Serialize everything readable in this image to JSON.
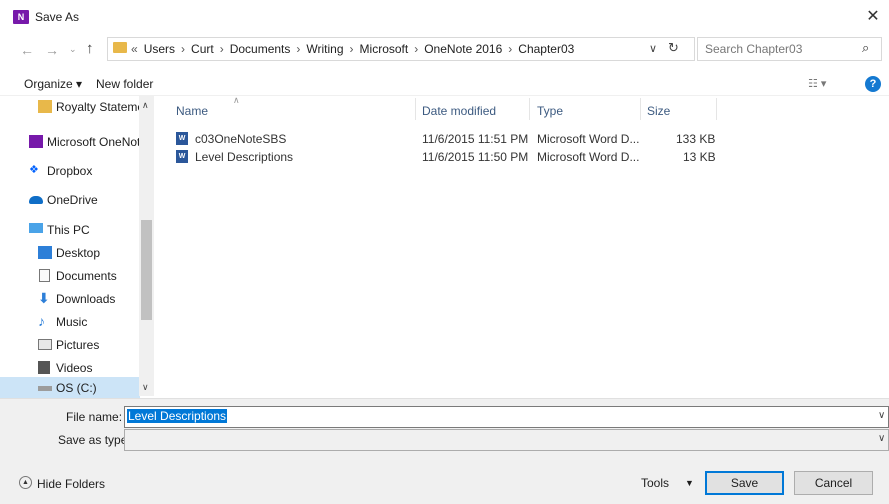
{
  "window": {
    "title": "Save As",
    "app_icon_text": "N",
    "close_glyph": "✕"
  },
  "address": {
    "overflow": "«",
    "path": [
      "Users",
      "Curt",
      "Documents",
      "Writing",
      "Microsoft",
      "OneNote 2016",
      "Chapter03"
    ],
    "search_placeholder": "Search Chapter03"
  },
  "toolbar": {
    "organize_label": "Organize ▾",
    "new_folder_label": "New folder"
  },
  "nav": {
    "items": [
      {
        "label": "Royalty Stateme",
        "icon": "folder-icon"
      },
      {
        "label": "Microsoft OneNot",
        "icon": "onenote-icon"
      },
      {
        "label": "Dropbox",
        "icon": "dropbox-icon"
      },
      {
        "label": "OneDrive",
        "icon": "onedrive-icon"
      },
      {
        "label": "This PC",
        "icon": "computer-icon"
      },
      {
        "label": "Desktop",
        "icon": "desktop-icon"
      },
      {
        "label": "Documents",
        "icon": "documents-icon"
      },
      {
        "label": "Downloads",
        "icon": "downloads-icon"
      },
      {
        "label": "Music",
        "icon": "music-icon"
      },
      {
        "label": "Pictures",
        "icon": "pictures-icon"
      },
      {
        "label": "Videos",
        "icon": "videos-icon"
      },
      {
        "label": "OS (C:)",
        "icon": "drive-icon"
      }
    ]
  },
  "files": {
    "columns": [
      "Name",
      "Date modified",
      "Type",
      "Size"
    ],
    "rows": [
      {
        "name": "c03OneNoteSBS",
        "date": "11/6/2015 11:51 PM",
        "type": "Microsoft Word D...",
        "size": "133 KB"
      },
      {
        "name": "Level Descriptions",
        "date": "11/6/2015 11:50 PM",
        "type": "Microsoft Word D...",
        "size": "13 KB"
      }
    ]
  },
  "form": {
    "file_name_label": "File name:",
    "file_name_value": "Level Descriptions",
    "save_type_label": "Save as type:"
  },
  "footer": {
    "hide_folders": "Hide Folders",
    "tools": "Tools",
    "save": "Save",
    "cancel": "Cancel"
  },
  "colors": {
    "accent": "#0078d7",
    "onenote": "#7719aa",
    "word": "#2b579a"
  }
}
